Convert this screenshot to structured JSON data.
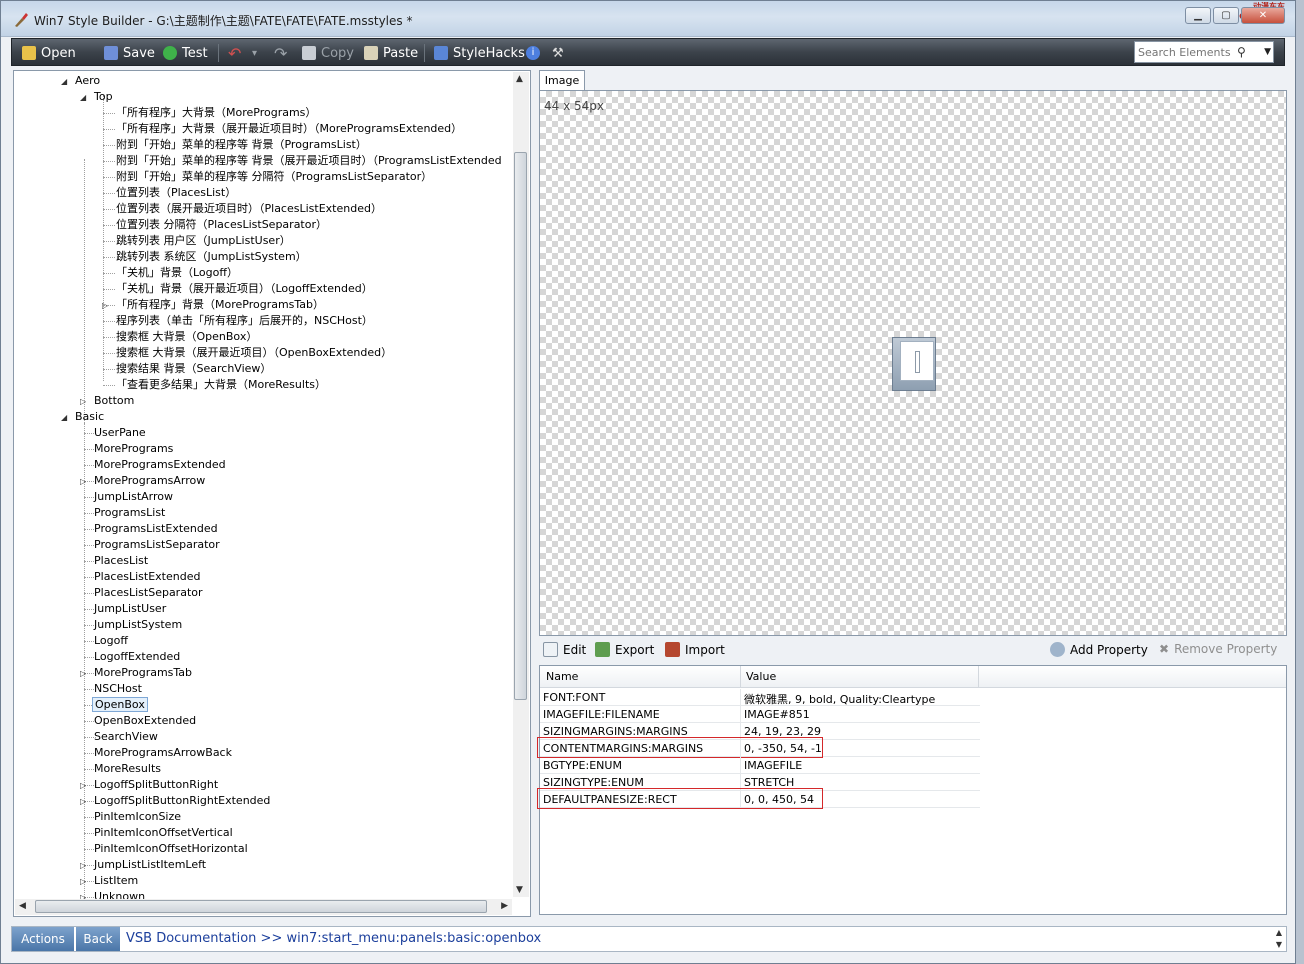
{
  "window": {
    "title": "Win7 Style Builder - G:\\主题制作\\主题\\FATE\\FATE\\FATE.msstyles *",
    "brand": "动漫东东\nCOMIC.DD.COM"
  },
  "toolbar": {
    "open": "Open",
    "save": "Save",
    "test": "Test",
    "copy": "Copy",
    "paste": "Paste",
    "stylehacks": "StyleHacks",
    "search_placeholder": "Search Elements"
  },
  "tree": {
    "aero": "Aero",
    "top": "Top",
    "top_items": [
      "「所有程序」大背景（MorePrograms）",
      "「所有程序」大背景（展开最近项目时）（MoreProgramsExtended）",
      "附到「开始」菜单的程序等 背景（ProgramsList）",
      "附到「开始」菜单的程序等 背景（展开最近项目时）（ProgramsListExtended",
      "附到「开始」菜单的程序等 分隔符（ProgramsListSeparator）",
      "位置列表（PlacesList）",
      "位置列表（展开最近项目时）（PlacesListExtended）",
      "位置列表 分隔符（PlacesListSeparator）",
      "跳转列表 用户区（JumpListUser）",
      "跳转列表 系统区（JumpListSystem）",
      "「关机」背景（Logoff）",
      "「关机」背景（展开最近项目）（LogoffExtended）",
      "「所有程序」背景（MoreProgramsTab）",
      "程序列表（单击「所有程序」后展开的，NSCHost）",
      "搜索框 大背景（OpenBox）",
      "搜索框 大背景（展开最近项目）（OpenBoxExtended）",
      "搜索结果 背景（SearchView）",
      "「查看更多结果」大背景（MoreResults）"
    ],
    "bottom": "Bottom",
    "basic": "Basic",
    "basic_items": [
      "UserPane",
      "MorePrograms",
      "MoreProgramsExtended",
      "MoreProgramsArrow",
      "JumpListArrow",
      "ProgramsList",
      "ProgramsListExtended",
      "ProgramsListSeparator",
      "PlacesList",
      "PlacesListExtended",
      "PlacesListSeparator",
      "JumpListUser",
      "JumpListSystem",
      "Logoff",
      "LogoffExtended",
      "MoreProgramsTab",
      "NSCHost",
      "OpenBox",
      "OpenBoxExtended",
      "SearchView",
      "MoreProgramsArrowBack",
      "MoreResults",
      "LogoffSplitButtonRight",
      "LogoffSplitButtonRightExtended",
      "PinItemIconSize",
      "PinItemIconOffsetVertical",
      "PinItemIconOffsetHorizontal",
      "JumpListListItemLeft",
      "ListItem",
      "Unknown"
    ],
    "selected": "OpenBox"
  },
  "image_panel": {
    "tab": "Image",
    "size_label": "44 x 54px"
  },
  "props_toolbar": {
    "edit": "Edit",
    "export": "Export",
    "import": "Import",
    "add": "Add Property",
    "remove": "Remove Property"
  },
  "props": {
    "col_name": "Name",
    "col_value": "Value",
    "rows": [
      {
        "name": "FONT:FONT",
        "value": "微软雅黑, 9, bold, Quality:Cleartype"
      },
      {
        "name": "IMAGEFILE:FILENAME",
        "value": "IMAGE#851"
      },
      {
        "name": "SIZINGMARGINS:MARGINS",
        "value": "24, 19, 23, 29"
      },
      {
        "name": "CONTENTMARGINS:MARGINS",
        "value": "0, -350, 54, -1"
      },
      {
        "name": "BGTYPE:ENUM",
        "value": "IMAGEFILE"
      },
      {
        "name": "SIZINGTYPE:ENUM",
        "value": "STRETCH"
      },
      {
        "name": "DEFAULTPANESIZE:RECT",
        "value": "0, 0, 450, 54"
      }
    ]
  },
  "statusbar": {
    "actions": "Actions",
    "back": "Back",
    "link": "VSB Documentation >> win7:start_menu:panels:basic:openbox"
  }
}
